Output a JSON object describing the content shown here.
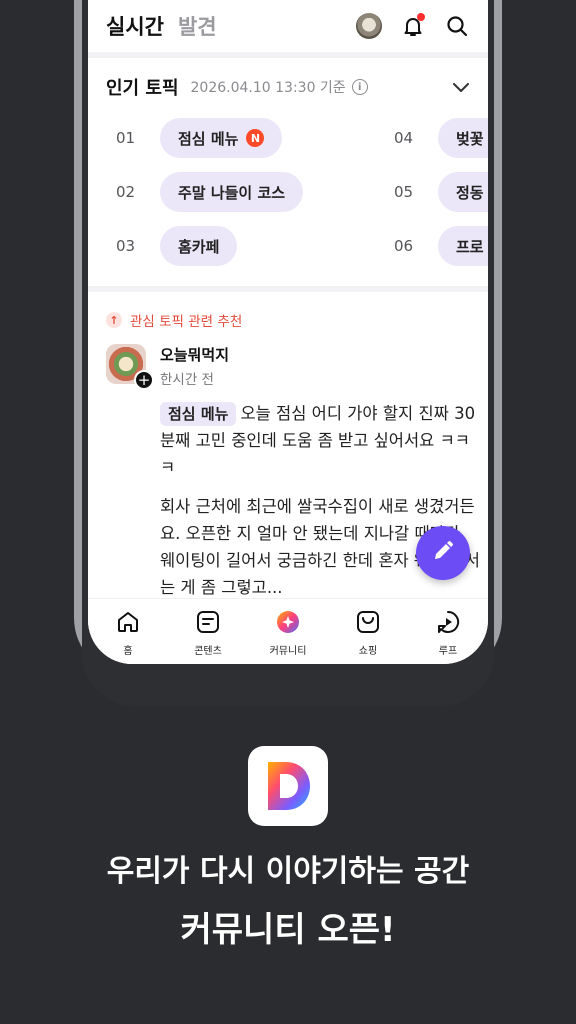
{
  "header": {
    "tab_realtime": "실시간",
    "tab_discover": "발견"
  },
  "topics": {
    "title": "인기 토픽",
    "timestamp": "2026.04.10 13:30 기준",
    "items": [
      {
        "rank": "01",
        "label": "점심 메뉴",
        "new": "N"
      },
      {
        "rank": "02",
        "label": "주말 나들이 코스"
      },
      {
        "rank": "03",
        "label": "홈카페"
      },
      {
        "rank": "04",
        "label": "벚꽃"
      },
      {
        "rank": "05",
        "label": "정동"
      },
      {
        "rank": "06",
        "label": "프로"
      }
    ]
  },
  "post": {
    "recommend_label": "관심 토픽 관련 추천",
    "author": "오늘뭐먹지",
    "time": "한시간 전",
    "tag": "점심 메뉴",
    "text1": "오늘 점심 어디 가야 할지 진짜 30분째 고민 중인데 도움 좀 받고 싶어서요 ㅋㅋㅋ",
    "text2": "회사 근처에 최근에 쌀국수집이 새로 생겼거든요. 오픈한 지 얼마 안 됐는데 지나갈 때마다 웨이팅이 길어서 궁금하긴 한데 혼자 웨이팅 서는 게 좀 그렇고..."
  },
  "nav": [
    {
      "label": "홈",
      "icon": "home-icon"
    },
    {
      "label": "콘텐츠",
      "icon": "contents-icon"
    },
    {
      "label": "커뮤니티",
      "icon": "community-icon"
    },
    {
      "label": "쇼핑",
      "icon": "shopping-icon"
    },
    {
      "label": "루프",
      "icon": "loop-icon"
    }
  ],
  "promo": {
    "line1": "우리가 다시 이야기하는 공간",
    "line2": "커뮤니티 오픈!"
  },
  "colors": {
    "accent": "#6c4cf5",
    "pill_bg": "#ebe7f8",
    "new_badge": "#ff4a2a",
    "background": "#2b2c30"
  }
}
